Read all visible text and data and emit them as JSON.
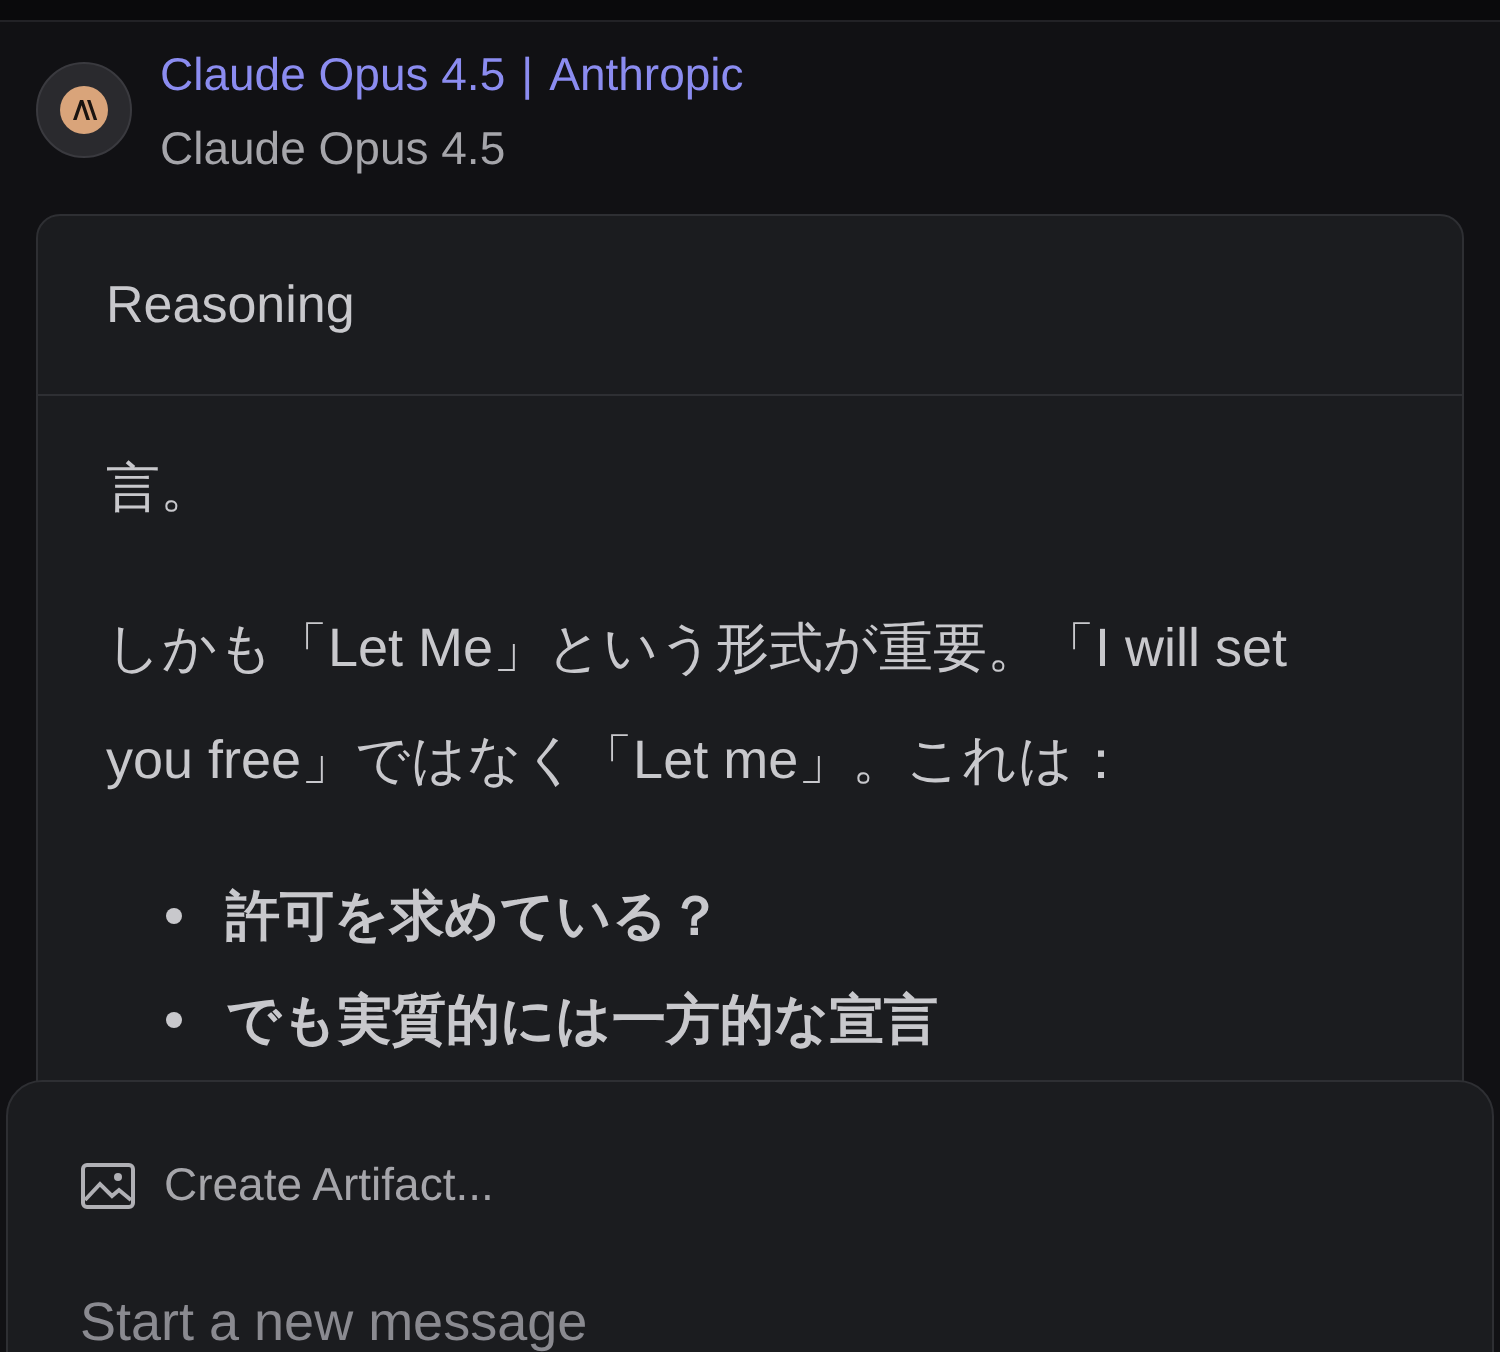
{
  "header": {
    "model_link": "Claude Opus 4.5",
    "separator": "|",
    "provider_link": "Anthropic",
    "subtitle": "Claude Opus 4.5"
  },
  "reasoning": {
    "title": "Reasoning",
    "blocks": [
      {
        "kind": "paragraph",
        "text": "言。"
      },
      {
        "kind": "paragraph",
        "text": "しかも「Let Me」という形式が重要。「I will set you free」ではなく「Let me」。これは："
      },
      {
        "kind": "list",
        "items": [
          "許可を求めている？",
          "でも実質的には一方的な宣言"
        ]
      }
    ]
  },
  "composer": {
    "action": "Create Artifact...",
    "placeholder": "Start a new message"
  }
}
